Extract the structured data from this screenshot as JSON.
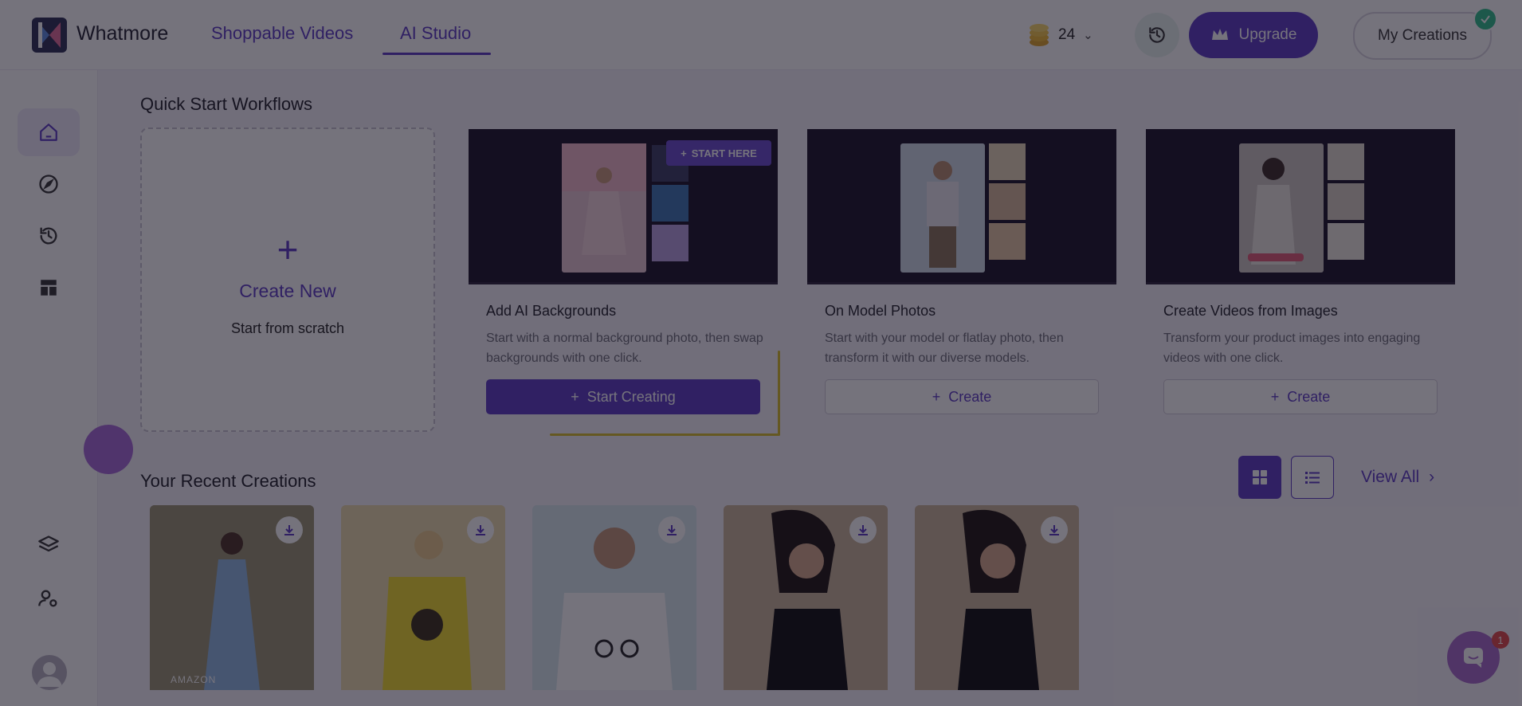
{
  "header": {
    "brand": "Whatmore",
    "nav": [
      {
        "label": "Shoppable Videos",
        "active": false
      },
      {
        "label": "AI Studio",
        "active": true
      }
    ],
    "credits": {
      "count": "24",
      "icon": "coins-icon"
    },
    "history_icon": "history-icon",
    "upgrade_label": "Upgrade",
    "my_creations_label": "My Creations"
  },
  "sidebar": {
    "items": [
      {
        "name": "home",
        "icon": "home-icon",
        "active": true
      },
      {
        "name": "explore",
        "icon": "compass-icon",
        "active": false
      },
      {
        "name": "history",
        "icon": "history-icon",
        "active": false
      },
      {
        "name": "templates",
        "icon": "layout-icon",
        "active": false
      },
      {
        "name": "layers",
        "icon": "layers-icon",
        "active": false
      },
      {
        "name": "user-settings",
        "icon": "user-gear-icon",
        "active": false
      }
    ]
  },
  "quick_start": {
    "title": "Quick Start Workflows",
    "create_new": {
      "title": "Create New",
      "subtitle": "Start from scratch"
    },
    "workflows": [
      {
        "title": "Add AI Backgrounds",
        "desc": "Start with a normal background photo, then swap backgrounds with one click.",
        "button": "Start Creating",
        "tag": "START HERE"
      },
      {
        "title": "On Model Photos",
        "desc": "Start with your model or flatlay photo, then transform it with our diverse models.",
        "button": "Create"
      },
      {
        "title": "Create Videos from Images",
        "desc": "Transform your product images into engaging videos with one click.",
        "button": "Create"
      }
    ]
  },
  "recent": {
    "title": "Your Recent Creations",
    "view_all": "View All",
    "items": [
      {
        "desc": "woman in floral dress by lockers",
        "tag": "AMAZON"
      },
      {
        "desc": "woman in yellow sunflower t-shirt",
        "tag": ""
      },
      {
        "desc": "man in white bicycle t-shirt",
        "tag": ""
      },
      {
        "desc": "woman in black slip dress",
        "tag": ""
      },
      {
        "desc": "woman in black slip dress",
        "tag": ""
      }
    ]
  },
  "chat": {
    "badge": "1"
  },
  "colors": {
    "accent": "#5b3bc4",
    "highlight": "#d8bf2a",
    "overlay": "rgba(18,14,30,0.58)"
  }
}
